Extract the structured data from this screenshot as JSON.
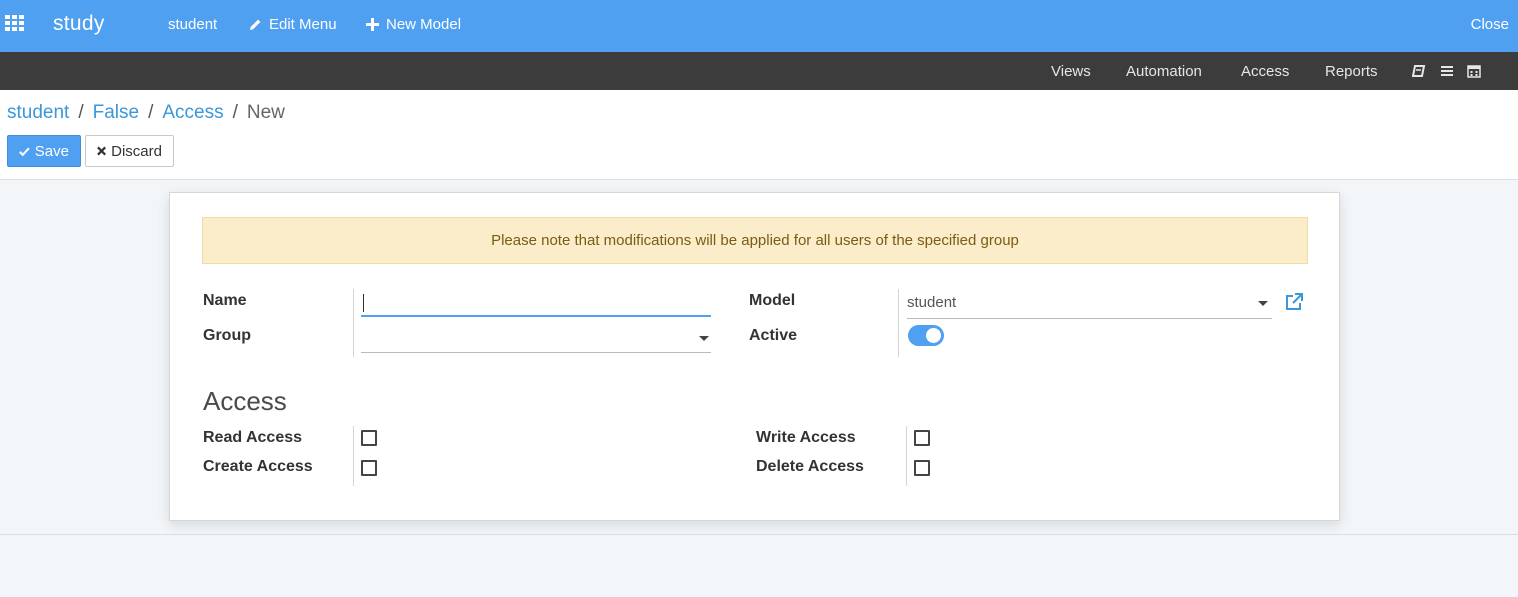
{
  "topbar": {
    "app_name": "study",
    "menu": [
      {
        "label": "student",
        "icon": ""
      },
      {
        "label": "Edit Menu",
        "icon": "pencil-icon"
      },
      {
        "label": "New Model",
        "icon": "plus-icon"
      }
    ],
    "close_label": "Close",
    "background": "#4fa0f0"
  },
  "subbar": {
    "items": [
      "Views",
      "Automation",
      "Access",
      "Reports"
    ],
    "icons": [
      "book-icon",
      "list-icon",
      "calendar-icon"
    ]
  },
  "breadcrumb": {
    "items": [
      "student",
      "False",
      "Access"
    ],
    "current": "New"
  },
  "buttons": {
    "save": "Save",
    "discard": "Discard"
  },
  "form": {
    "alert": "Please note that modifications will be applied for all users of the specified group",
    "name_label": "Name",
    "name_value": "",
    "group_label": "Group",
    "group_value": "",
    "model_label": "Model",
    "model_value": "student",
    "active_label": "Active",
    "active": true,
    "access_title": "Access",
    "read_label": "Read Access",
    "create_label": "Create Access",
    "write_label": "Write Access",
    "delete_label": "Delete Access",
    "read_checked": false,
    "create_checked": false,
    "write_checked": false,
    "delete_checked": false
  }
}
